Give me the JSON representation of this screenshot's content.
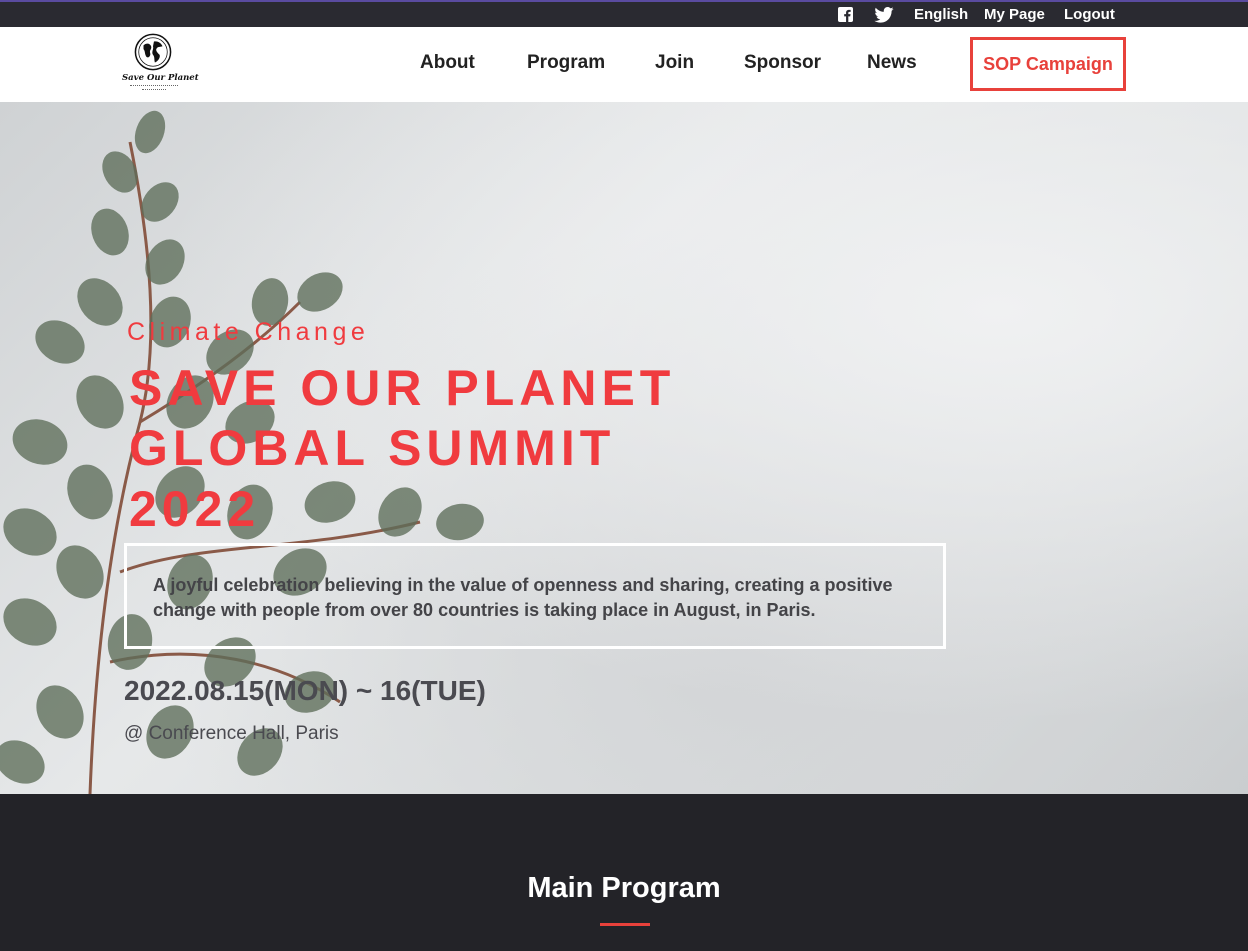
{
  "topbar": {
    "icons": [
      "facebook-icon",
      "twitter-icon"
    ],
    "links": [
      "English",
      "My Page",
      "Logout"
    ]
  },
  "header": {
    "logo_text": "Save Our Planet",
    "nav": [
      "About",
      "Program",
      "Join",
      "Sponsor",
      "News"
    ],
    "campaign_label": "SOP Campaign"
  },
  "hero": {
    "eyebrow": "Climate Change",
    "title_lines": [
      "SAVE OUR PLANET",
      "GLOBAL SUMMIT",
      "2022"
    ],
    "description_lines": [
      "A joyful celebration believing in the value of openness and sharing, creating a positive",
      "change with people from over 80 countries is taking place in August, in Paris."
    ],
    "date": "2022.08.15(MON) ~ 16(TUE)",
    "venue": "@ Conference Hall, Paris"
  },
  "program": {
    "title": "Main Program"
  },
  "colors": {
    "accent": "#e8413b",
    "hero_red": "#f03b3f",
    "dark_bg": "#232328"
  }
}
